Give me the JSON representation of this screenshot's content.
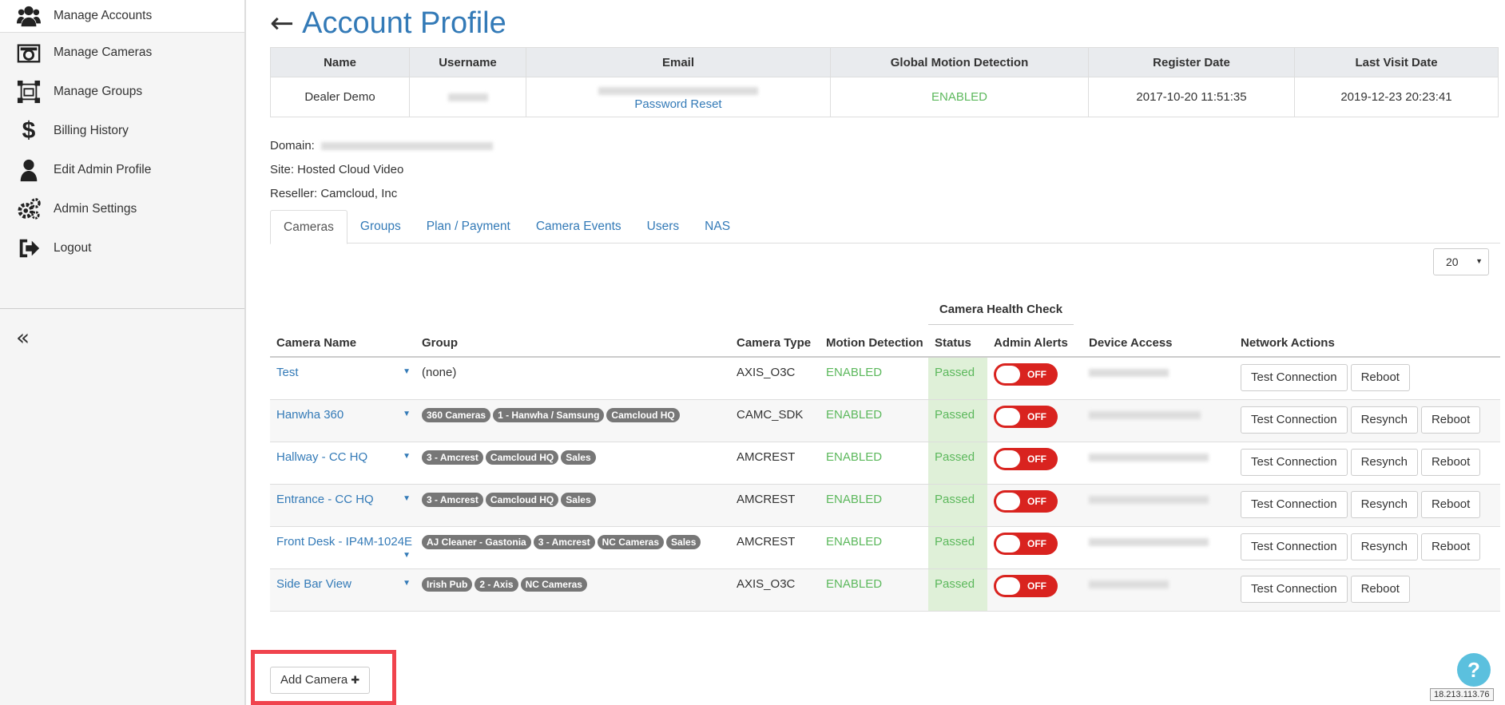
{
  "sidebar": {
    "items": [
      {
        "label": "Manage Accounts",
        "icon": "users-icon"
      },
      {
        "label": "Manage Cameras",
        "icon": "camera-icon"
      },
      {
        "label": "Manage Groups",
        "icon": "groups-icon"
      },
      {
        "label": "Billing History",
        "icon": "dollar-icon"
      },
      {
        "label": "Edit Admin Profile",
        "icon": "user-icon"
      },
      {
        "label": "Admin Settings",
        "icon": "gears-icon"
      },
      {
        "label": "Logout",
        "icon": "logout-icon"
      }
    ],
    "collapse": "«"
  },
  "header": {
    "back": "←",
    "title": "Account Profile"
  },
  "summary": {
    "headers": [
      "Name",
      "Username",
      "Email",
      "Global Motion Detection",
      "Register Date",
      "Last Visit Date"
    ],
    "name": "Dealer Demo",
    "password_reset": "Password Reset",
    "motion": "ENABLED",
    "register": "2017-10-20 11:51:35",
    "last_visit": "2019-12-23 20:23:41"
  },
  "meta": {
    "domain_label": "Domain:",
    "site": "Site: Hosted Cloud Video",
    "reseller": "Reseller: Camcloud, Inc"
  },
  "tabs": [
    "Cameras",
    "Groups",
    "Plan / Payment",
    "Camera Events",
    "Users",
    "NAS"
  ],
  "page_size": "20",
  "health_check_label": "Camera Health Check",
  "cam_headers": [
    "Camera Name",
    "Group",
    "Camera Type",
    "Motion Detection",
    "Status",
    "Admin Alerts",
    "Device Access",
    "Network Actions"
  ],
  "cameras": [
    {
      "name": "Test",
      "group_text": "(none)",
      "type": "AXIS_O3C",
      "motion": "ENABLED",
      "status": "Passed",
      "alert": "OFF",
      "actions": [
        "Test Connection",
        "Reboot"
      ]
    },
    {
      "name": "Hanwha 360",
      "groups": [
        "360 Cameras",
        "1 - Hanwha / Samsung",
        "Camcloud HQ"
      ],
      "type": "CAMC_SDK",
      "motion": "ENABLED",
      "status": "Passed",
      "alert": "OFF",
      "actions": [
        "Test Connection",
        "Resynch",
        "Reboot"
      ]
    },
    {
      "name": "Hallway - CC HQ",
      "groups": [
        "3 - Amcrest",
        "Camcloud HQ",
        "Sales"
      ],
      "type": "AMCREST",
      "motion": "ENABLED",
      "status": "Passed",
      "alert": "OFF",
      "actions": [
        "Test Connection",
        "Resynch",
        "Reboot"
      ]
    },
    {
      "name": "Entrance - CC HQ",
      "groups": [
        "3 - Amcrest",
        "Camcloud HQ",
        "Sales"
      ],
      "type": "AMCREST",
      "motion": "ENABLED",
      "status": "Passed",
      "alert": "OFF",
      "actions": [
        "Test Connection",
        "Resynch",
        "Reboot"
      ]
    },
    {
      "name": "Front Desk - IP4M-1024E",
      "groups": [
        "AJ Cleaner - Gastonia",
        "3 - Amcrest",
        "NC Cameras",
        "Sales"
      ],
      "type": "AMCREST",
      "motion": "ENABLED",
      "status": "Passed",
      "alert": "OFF",
      "actions": [
        "Test Connection",
        "Resynch",
        "Reboot"
      ]
    },
    {
      "name": "Side Bar View",
      "groups": [
        "Irish Pub",
        "2 - Axis",
        "NC Cameras"
      ],
      "type": "AXIS_O3C",
      "motion": "ENABLED",
      "status": "Passed",
      "alert": "OFF",
      "actions": [
        "Test Connection",
        "Reboot"
      ]
    }
  ],
  "add_camera": "Add Camera",
  "add_icon": "✚",
  "help": "?",
  "ip": "18.213.113.76"
}
